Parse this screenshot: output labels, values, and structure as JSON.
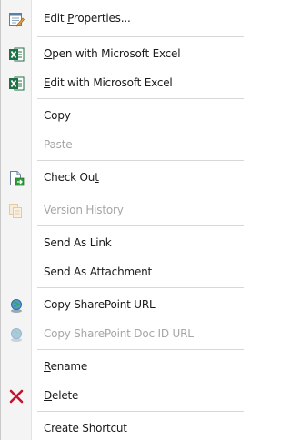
{
  "menu": {
    "items": [
      {
        "label": "Edit Properties...",
        "accel": "P",
        "icon": "edit-properties-icon",
        "enabled": true
      },
      {
        "label": "Open with Microsoft Excel",
        "accel": "O",
        "icon": "excel-icon",
        "enabled": true
      },
      {
        "label": "Edit with Microsoft Excel",
        "accel": "E",
        "icon": "excel-icon",
        "enabled": true
      },
      {
        "label": "Copy",
        "accel": "",
        "icon": "",
        "enabled": true
      },
      {
        "label": "Paste",
        "accel": "",
        "icon": "",
        "enabled": false
      },
      {
        "label": "Check Out",
        "accel": "t",
        "icon": "check-out-icon",
        "enabled": true
      },
      {
        "label": "Version History",
        "accel": "",
        "icon": "version-history-icon",
        "enabled": false
      },
      {
        "label": "Send As Link",
        "accel": "",
        "icon": "",
        "enabled": true
      },
      {
        "label": "Send As Attachment",
        "accel": "",
        "icon": "",
        "enabled": true
      },
      {
        "label": "Copy SharePoint URL",
        "accel": "",
        "icon": "sharepoint-globe-icon",
        "enabled": true
      },
      {
        "label": "Copy SharePoint Doc ID URL",
        "accel": "",
        "icon": "sharepoint-globe-icon",
        "enabled": false
      },
      {
        "label": "Rename",
        "accel": "R",
        "icon": "",
        "enabled": true
      },
      {
        "label": "Delete",
        "accel": "D",
        "icon": "delete-x-icon",
        "enabled": true
      },
      {
        "label": "Create Shortcut",
        "accel": "",
        "icon": "",
        "enabled": true
      }
    ]
  },
  "colors": {
    "excel_green": "#1e7145",
    "delete_red": "#c8102e",
    "disabled_text": "#a6a6a6",
    "separator": "#d8d8d8"
  }
}
